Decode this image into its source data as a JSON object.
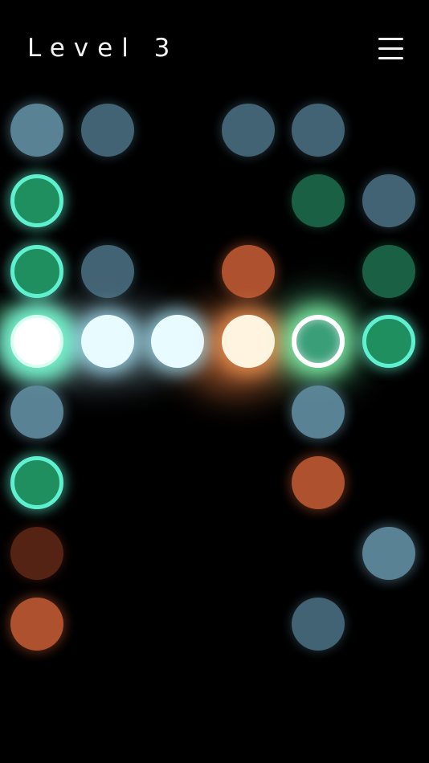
{
  "header": {
    "level_label": "Level 3"
  },
  "colors": {
    "background": "#000000",
    "blue": "#5e8a9c",
    "blue_dim": "#4a6e80",
    "green": "#1f8f60",
    "green_dim": "#1d6b4c",
    "teal_ring": "#5ff0d0",
    "orange": "#c05a34",
    "orange_dim": "#6a2c1a",
    "lit_white": "#ffffff",
    "lit_cyan": "#e8fbff",
    "lit_warm": "#fff4e0"
  },
  "grid": {
    "columns": 6,
    "rows": 8
  },
  "nodes": [
    {
      "col": 0,
      "row": 0,
      "state": "blue"
    },
    {
      "col": 1,
      "row": 0,
      "state": "blue_dim"
    },
    {
      "col": 3,
      "row": 0,
      "state": "blue_dim"
    },
    {
      "col": 4,
      "row": 0,
      "state": "blue_dim"
    },
    {
      "col": 0,
      "row": 1,
      "state": "green_ring"
    },
    {
      "col": 4,
      "row": 1,
      "state": "green_dim"
    },
    {
      "col": 5,
      "row": 1,
      "state": "blue_dim"
    },
    {
      "col": 0,
      "row": 2,
      "state": "green_ring"
    },
    {
      "col": 1,
      "row": 2,
      "state": "blue_dim"
    },
    {
      "col": 3,
      "row": 2,
      "state": "orange"
    },
    {
      "col": 5,
      "row": 2,
      "state": "green_dim"
    },
    {
      "col": 0,
      "row": 3,
      "state": "lit_white"
    },
    {
      "col": 1,
      "row": 3,
      "state": "lit_cyan"
    },
    {
      "col": 2,
      "row": 3,
      "state": "lit_cyan"
    },
    {
      "col": 3,
      "row": 3,
      "state": "lit_warm"
    },
    {
      "col": 4,
      "row": 3,
      "state": "lit_ring"
    },
    {
      "col": 5,
      "row": 3,
      "state": "green_ring"
    },
    {
      "col": 0,
      "row": 4,
      "state": "blue"
    },
    {
      "col": 4,
      "row": 4,
      "state": "blue"
    },
    {
      "col": 0,
      "row": 5,
      "state": "green_ring"
    },
    {
      "col": 4,
      "row": 5,
      "state": "orange"
    },
    {
      "col": 0,
      "row": 6,
      "state": "orange_dim"
    },
    {
      "col": 5,
      "row": 6,
      "state": "blue"
    },
    {
      "col": 0,
      "row": 7,
      "state": "orange"
    },
    {
      "col": 4,
      "row": 7,
      "state": "blue_dim"
    }
  ]
}
